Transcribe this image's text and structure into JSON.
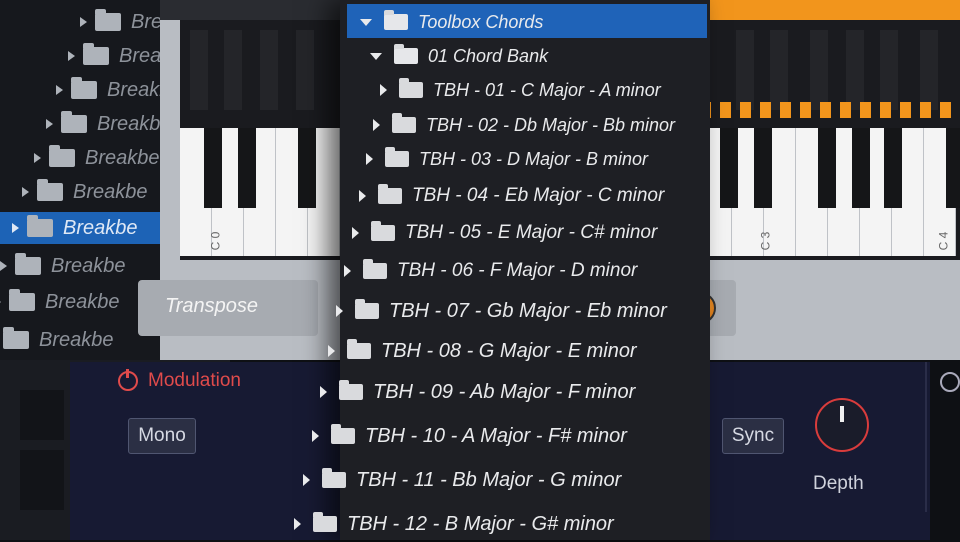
{
  "background_browser": {
    "items": [
      {
        "label": "Breakbe"
      },
      {
        "label": "Breakb"
      },
      {
        "label": "Breakbe"
      },
      {
        "label": "Breakbe"
      },
      {
        "label": "Breakbe"
      },
      {
        "label": "Breakbe"
      },
      {
        "label": "Breakbe"
      },
      {
        "label": "Breakbe"
      },
      {
        "label": "Breakbe"
      },
      {
        "label": "Breakbe"
      }
    ]
  },
  "keyboard": {
    "octave_labels": [
      "C 0",
      "C 3",
      "C 4"
    ]
  },
  "instrument": {
    "transpose_label": "Transpose"
  },
  "modulation": {
    "title": "Modulation",
    "mono_label": "Mono",
    "sync_label": "Sync",
    "depth_label": "Depth"
  },
  "dropdown": {
    "root": "Toolbox Chords",
    "bank": "01 Chord Bank",
    "items": [
      "TBH - 01 - C Major - A minor",
      "TBH - 02 - Db Major - Bb minor",
      "TBH - 03 - D Major - B minor",
      "TBH - 04 - Eb Major - C minor",
      "TBH - 05 - E Major - C# minor",
      "TBH - 06 - F Major - D minor",
      "TBH - 07 - Gb Major - Eb minor",
      "TBH - 08 - G Major - E minor",
      "TBH - 09 - Ab Major - F minor",
      "TBH - 10 - A Major - F# minor",
      "TBH - 11 - Bb Major - G minor",
      "TBH - 12 - B Major - G# minor"
    ]
  },
  "colors": {
    "selection": "#1f63b8",
    "accent_orange": "#f2951c",
    "modulation_red": "#e04b4b"
  }
}
